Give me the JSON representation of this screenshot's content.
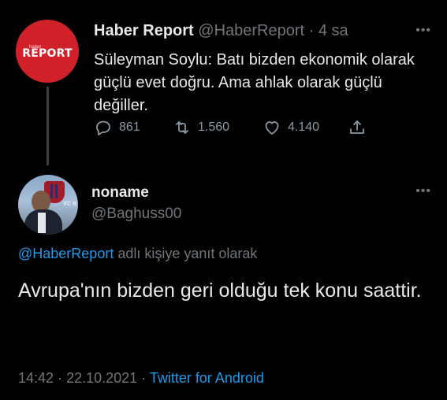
{
  "parent_tweet": {
    "avatar_small_text": "haber",
    "avatar_big_text": "REPORT",
    "display_name": "Haber Report",
    "handle": "@HaberReport",
    "separator": "·",
    "time_ago": "4 sa",
    "more_label": "•••",
    "text": "Süleyman Soylu: Batı bizden ekonomik olarak güçlü evet doğru. Ama ahlak olarak güçlü değiller.",
    "reply_count": "861",
    "retweet_count": "1.560",
    "like_count": "4.140"
  },
  "reply_tweet": {
    "avatar_text": "FC B",
    "display_name": "noname",
    "handle": "@Baghuss00",
    "more_label": "•••",
    "replying_mention": "@HaberReport",
    "replying_suffix": "adlı kişiye yanıt olarak",
    "text": "Avrupa'nın bizden geri olduğu tek konu saattir.",
    "time": "14:42",
    "dot": "·",
    "date": "22.10.2021",
    "source": "Twitter for Android"
  },
  "colors": {
    "background": "#000000",
    "text_primary": "#e7e9ea",
    "text_secondary": "#71767b",
    "link": "#1d9bf0",
    "avatar_red": "#d0202a"
  },
  "icons": {
    "reply": "reply-icon",
    "retweet": "retweet-icon",
    "like": "heart-icon",
    "share": "share-icon",
    "more": "more-icon"
  }
}
